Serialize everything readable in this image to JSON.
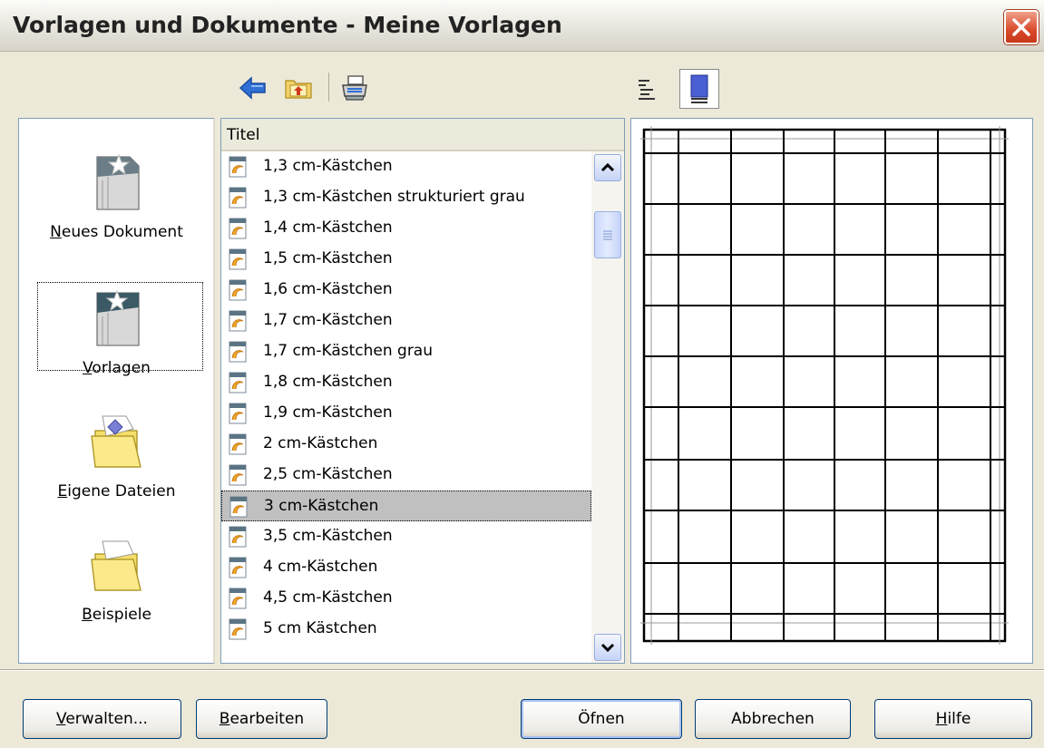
{
  "window": {
    "title": "Vorlagen und Dokumente - Meine Vorlagen"
  },
  "categories": [
    {
      "label_pre": "",
      "label_u": "N",
      "label_post": "eues Dokument",
      "icon": "new-document-icon"
    },
    {
      "label_pre": "",
      "label_u": "V",
      "label_post": "orlagen",
      "icon": "templates-icon",
      "selected": true
    },
    {
      "label_pre": "",
      "label_u": "E",
      "label_post": "igene Dateien",
      "icon": "my-documents-folder-icon"
    },
    {
      "label_pre": "",
      "label_u": "B",
      "label_post": "eispiele",
      "icon": "samples-folder-icon"
    }
  ],
  "list": {
    "header": "Titel",
    "rows": [
      "1,3 cm-Kästchen",
      "1,3 cm-Kästchen strukturiert grau",
      "1,4 cm-Kästchen",
      "1,5 cm-Kästchen",
      "1,6 cm-Kästchen",
      "1,7 cm-Kästchen",
      "1,7 cm-Kästchen grau",
      "1,8 cm-Kästchen",
      "1,9 cm-Kästchen",
      "2 cm-Kästchen",
      "2,5 cm-Kästchen",
      "3 cm-Kästchen",
      "3,5 cm-Kästchen",
      "4 cm-Kästchen",
      "4,5 cm-Kästchen",
      "5 cm Kästchen"
    ],
    "selected_index": 11
  },
  "buttons": {
    "manage": {
      "u": "V",
      "rest": "erwalten..."
    },
    "edit": {
      "u": "B",
      "rest": "earbeiten"
    },
    "open_pre": "Öf",
    "open_u": "f",
    "open_post": "nen",
    "cancel": "Abbrechen",
    "help": {
      "u": "H",
      "rest": "ilfe"
    }
  },
  "colors": {
    "selection": "#c1c0c1",
    "panel_border": "#7f9db9",
    "dialog_bg": "#ece9d8"
  }
}
